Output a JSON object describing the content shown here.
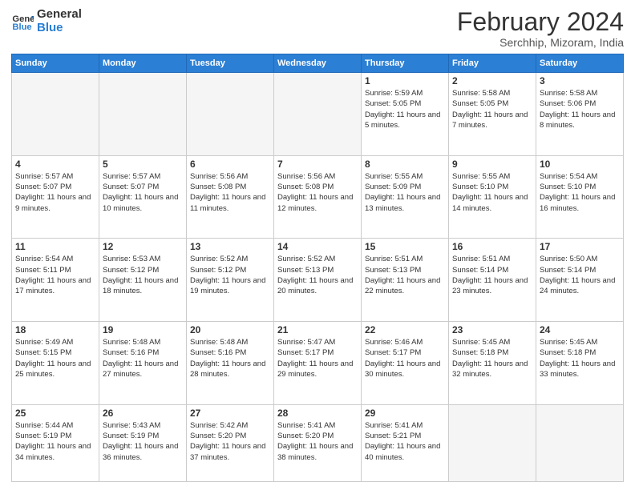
{
  "logo": {
    "line1": "General",
    "line2": "Blue"
  },
  "title": "February 2024",
  "subtitle": "Serchhip, Mizoram, India",
  "days_of_week": [
    "Sunday",
    "Monday",
    "Tuesday",
    "Wednesday",
    "Thursday",
    "Friday",
    "Saturday"
  ],
  "weeks": [
    [
      {
        "day": "",
        "info": ""
      },
      {
        "day": "",
        "info": ""
      },
      {
        "day": "",
        "info": ""
      },
      {
        "day": "",
        "info": ""
      },
      {
        "day": "1",
        "info": "Sunrise: 5:59 AM\nSunset: 5:05 PM\nDaylight: 11 hours\nand 5 minutes."
      },
      {
        "day": "2",
        "info": "Sunrise: 5:58 AM\nSunset: 5:05 PM\nDaylight: 11 hours\nand 7 minutes."
      },
      {
        "day": "3",
        "info": "Sunrise: 5:58 AM\nSunset: 5:06 PM\nDaylight: 11 hours\nand 8 minutes."
      }
    ],
    [
      {
        "day": "4",
        "info": "Sunrise: 5:57 AM\nSunset: 5:07 PM\nDaylight: 11 hours\nand 9 minutes."
      },
      {
        "day": "5",
        "info": "Sunrise: 5:57 AM\nSunset: 5:07 PM\nDaylight: 11 hours\nand 10 minutes."
      },
      {
        "day": "6",
        "info": "Sunrise: 5:56 AM\nSunset: 5:08 PM\nDaylight: 11 hours\nand 11 minutes."
      },
      {
        "day": "7",
        "info": "Sunrise: 5:56 AM\nSunset: 5:08 PM\nDaylight: 11 hours\nand 12 minutes."
      },
      {
        "day": "8",
        "info": "Sunrise: 5:55 AM\nSunset: 5:09 PM\nDaylight: 11 hours\nand 13 minutes."
      },
      {
        "day": "9",
        "info": "Sunrise: 5:55 AM\nSunset: 5:10 PM\nDaylight: 11 hours\nand 14 minutes."
      },
      {
        "day": "10",
        "info": "Sunrise: 5:54 AM\nSunset: 5:10 PM\nDaylight: 11 hours\nand 16 minutes."
      }
    ],
    [
      {
        "day": "11",
        "info": "Sunrise: 5:54 AM\nSunset: 5:11 PM\nDaylight: 11 hours\nand 17 minutes."
      },
      {
        "day": "12",
        "info": "Sunrise: 5:53 AM\nSunset: 5:12 PM\nDaylight: 11 hours\nand 18 minutes."
      },
      {
        "day": "13",
        "info": "Sunrise: 5:52 AM\nSunset: 5:12 PM\nDaylight: 11 hours\nand 19 minutes."
      },
      {
        "day": "14",
        "info": "Sunrise: 5:52 AM\nSunset: 5:13 PM\nDaylight: 11 hours\nand 20 minutes."
      },
      {
        "day": "15",
        "info": "Sunrise: 5:51 AM\nSunset: 5:13 PM\nDaylight: 11 hours\nand 22 minutes."
      },
      {
        "day": "16",
        "info": "Sunrise: 5:51 AM\nSunset: 5:14 PM\nDaylight: 11 hours\nand 23 minutes."
      },
      {
        "day": "17",
        "info": "Sunrise: 5:50 AM\nSunset: 5:14 PM\nDaylight: 11 hours\nand 24 minutes."
      }
    ],
    [
      {
        "day": "18",
        "info": "Sunrise: 5:49 AM\nSunset: 5:15 PM\nDaylight: 11 hours\nand 25 minutes."
      },
      {
        "day": "19",
        "info": "Sunrise: 5:48 AM\nSunset: 5:16 PM\nDaylight: 11 hours\nand 27 minutes."
      },
      {
        "day": "20",
        "info": "Sunrise: 5:48 AM\nSunset: 5:16 PM\nDaylight: 11 hours\nand 28 minutes."
      },
      {
        "day": "21",
        "info": "Sunrise: 5:47 AM\nSunset: 5:17 PM\nDaylight: 11 hours\nand 29 minutes."
      },
      {
        "day": "22",
        "info": "Sunrise: 5:46 AM\nSunset: 5:17 PM\nDaylight: 11 hours\nand 30 minutes."
      },
      {
        "day": "23",
        "info": "Sunrise: 5:45 AM\nSunset: 5:18 PM\nDaylight: 11 hours\nand 32 minutes."
      },
      {
        "day": "24",
        "info": "Sunrise: 5:45 AM\nSunset: 5:18 PM\nDaylight: 11 hours\nand 33 minutes."
      }
    ],
    [
      {
        "day": "25",
        "info": "Sunrise: 5:44 AM\nSunset: 5:19 PM\nDaylight: 11 hours\nand 34 minutes."
      },
      {
        "day": "26",
        "info": "Sunrise: 5:43 AM\nSunset: 5:19 PM\nDaylight: 11 hours\nand 36 minutes."
      },
      {
        "day": "27",
        "info": "Sunrise: 5:42 AM\nSunset: 5:20 PM\nDaylight: 11 hours\nand 37 minutes."
      },
      {
        "day": "28",
        "info": "Sunrise: 5:41 AM\nSunset: 5:20 PM\nDaylight: 11 hours\nand 38 minutes."
      },
      {
        "day": "29",
        "info": "Sunrise: 5:41 AM\nSunset: 5:21 PM\nDaylight: 11 hours\nand 40 minutes."
      },
      {
        "day": "",
        "info": ""
      },
      {
        "day": "",
        "info": ""
      }
    ]
  ]
}
